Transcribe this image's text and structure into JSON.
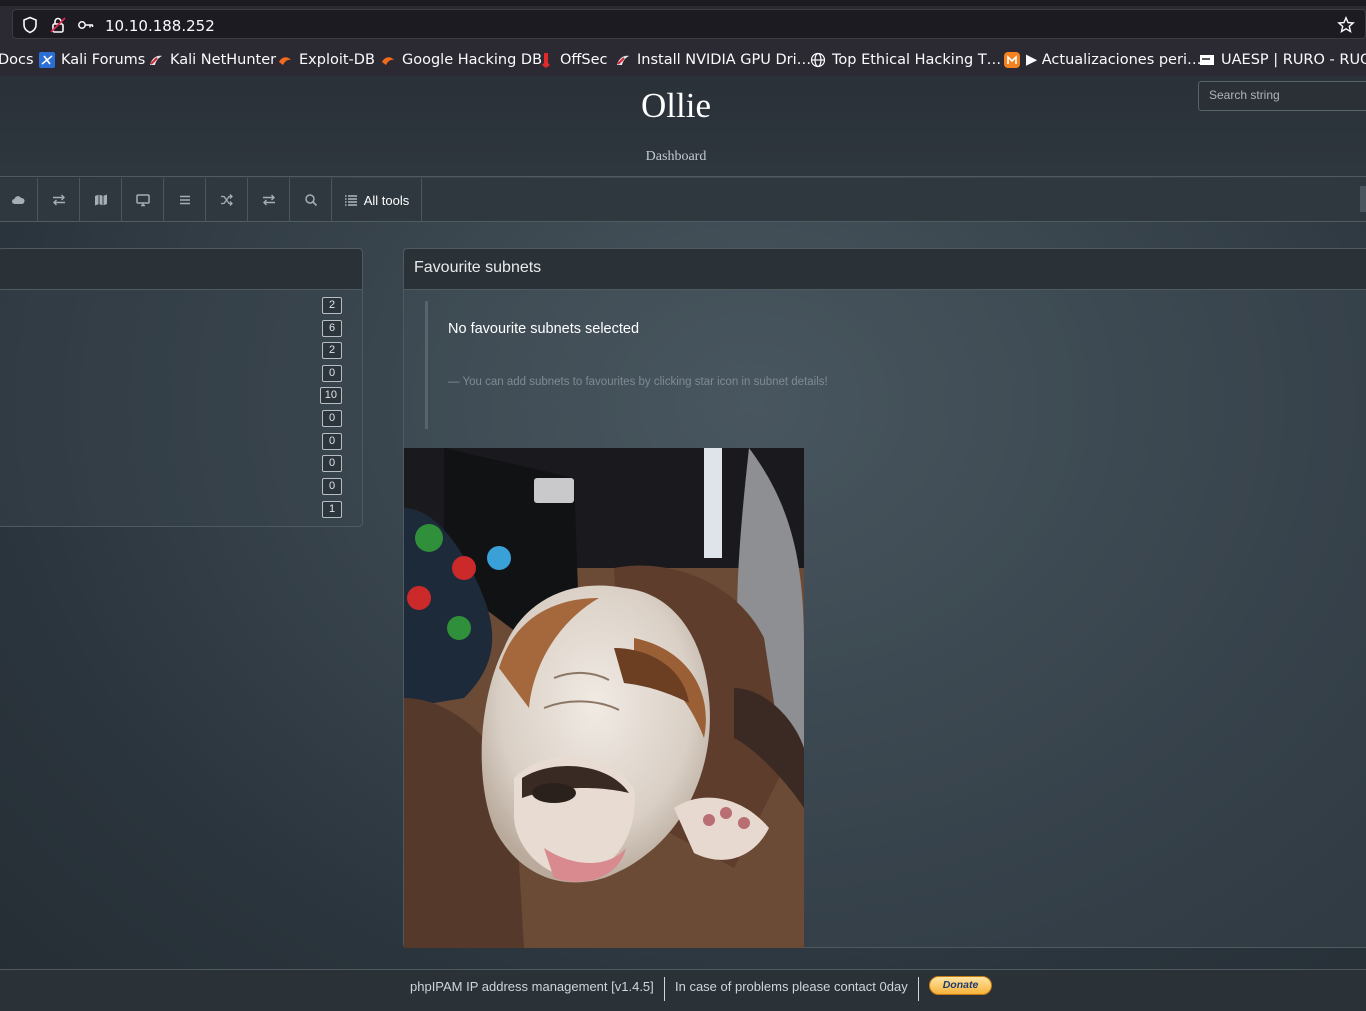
{
  "browser": {
    "url": "10.10.188.252",
    "bookmarks": [
      {
        "label": "Docs",
        "icon": "kali-icon"
      },
      {
        "label": "Kali Forums",
        "icon": "kali-icon"
      },
      {
        "label": "Kali NetHunter",
        "icon": "nethunter-icon"
      },
      {
        "label": "Exploit-DB",
        "icon": "exploitdb-icon"
      },
      {
        "label": "Google Hacking DB",
        "icon": "exploitdb-icon"
      },
      {
        "label": "OffSec",
        "icon": "offsec-icon"
      },
      {
        "label": "Install NVIDIA GPU Dri…",
        "icon": "nethunter-icon"
      },
      {
        "label": "Top Ethical Hacking T…",
        "icon": "globe-icon"
      },
      {
        "label": "▶ Actualizaciones peri…",
        "icon": "m-icon"
      },
      {
        "label": "UAESP | RURO - RUOR",
        "icon": "site-icon"
      }
    ]
  },
  "header": {
    "title": "Ollie",
    "subtitle": "Dashboard",
    "search_placeholder": "Search string"
  },
  "toolbar": {
    "all_tools_label": "All tools"
  },
  "left_panel": {
    "badges": [
      "2",
      "6",
      "2",
      "0",
      "10",
      "0",
      "0",
      "0",
      "0",
      "1"
    ]
  },
  "favourites": {
    "title": "Favourite subnets",
    "empty_message": "No favourite subnets selected",
    "hint": "— You can add subnets to favourites by clicking star icon in subnet details!"
  },
  "footer": {
    "version_text": "phpIPAM IP address management [v1.4.5]",
    "contact_text": "In case of problems please contact 0day",
    "donate_label": "Donate"
  },
  "colors": {
    "accent": "#f7b33a",
    "panel_header": "#2a3238",
    "background": "#3a464e"
  }
}
